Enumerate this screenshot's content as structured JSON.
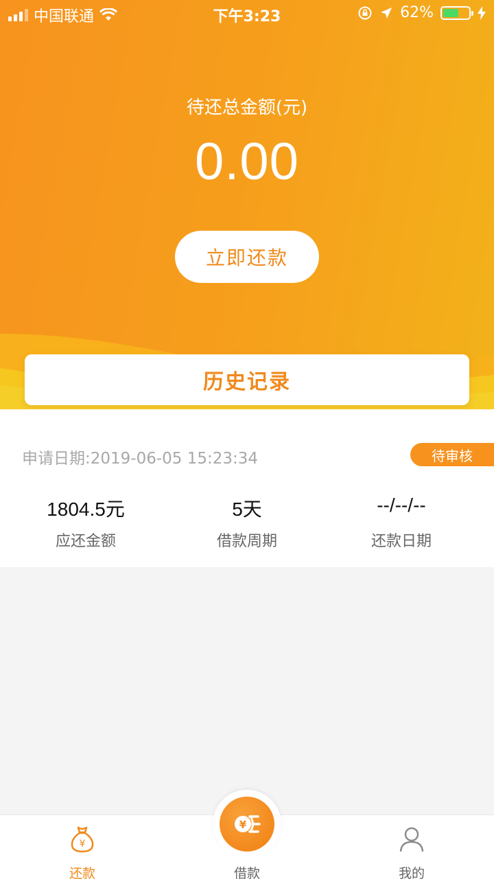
{
  "status_bar": {
    "carrier": "中国联通",
    "time": "下午3:23",
    "battery": "62%",
    "battery_level": 0.62
  },
  "summary": {
    "total_label": "待还总金额(元)",
    "total_amount": "0.00",
    "repay_button": "立即还款",
    "history_label": "历史记录"
  },
  "record": {
    "apply_date": "申请日期:2019-06-05 15:23:34",
    "status": "待审核",
    "stats": [
      {
        "value": "1804.5元",
        "label": "应还金额"
      },
      {
        "value": "5天",
        "label": "借款周期"
      },
      {
        "value": "--/--/--",
        "label": "还款日期"
      }
    ]
  },
  "tabs": [
    {
      "label": "还款",
      "icon": "money-bag-icon",
      "active": true
    },
    {
      "label": "借款",
      "icon": "coin-loan-icon",
      "active": false
    },
    {
      "label": "我的",
      "icon": "user-icon",
      "active": false
    }
  ],
  "colors": {
    "accent": "#f08a1c",
    "badge": "#f7921e"
  }
}
